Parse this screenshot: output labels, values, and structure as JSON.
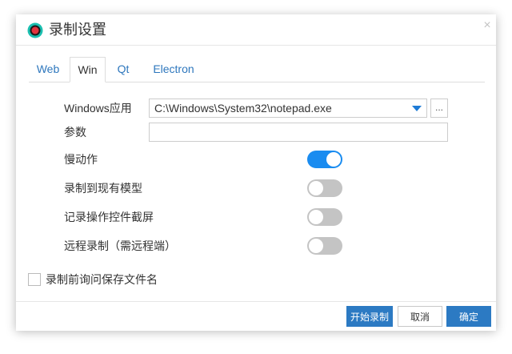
{
  "dialog": {
    "title": "录制设置",
    "close_glyph": "×",
    "title_icon": "record-icon"
  },
  "tabs": [
    {
      "label": "Web",
      "active": false
    },
    {
      "label": "Win",
      "active": true
    },
    {
      "label": "Qt",
      "active": false
    },
    {
      "label": "Electron",
      "active": false
    }
  ],
  "form": {
    "windows_app_label": "Windows应用",
    "windows_app_value": "C:\\Windows\\System32\\notepad.exe",
    "browse_label": "...",
    "params_label": "参数",
    "params_value": ""
  },
  "toggles": [
    {
      "label": "慢动作",
      "on": true
    },
    {
      "label": "录制到现有模型",
      "on": false
    },
    {
      "label": "记录操作控件截屏",
      "on": false
    },
    {
      "label": "远程录制（需远程端）",
      "on": false
    }
  ],
  "checkbox": {
    "label": "录制前询问保存文件名",
    "checked": false
  },
  "footer": {
    "start_label": "开始录制",
    "cancel_label": "取消",
    "ok_label": "确定"
  },
  "colors": {
    "accent": "#2c7ac3",
    "toggle_on": "#1a8cf0",
    "toggle_off": "#c4c4c4",
    "tab_link": "#2e77bd"
  }
}
